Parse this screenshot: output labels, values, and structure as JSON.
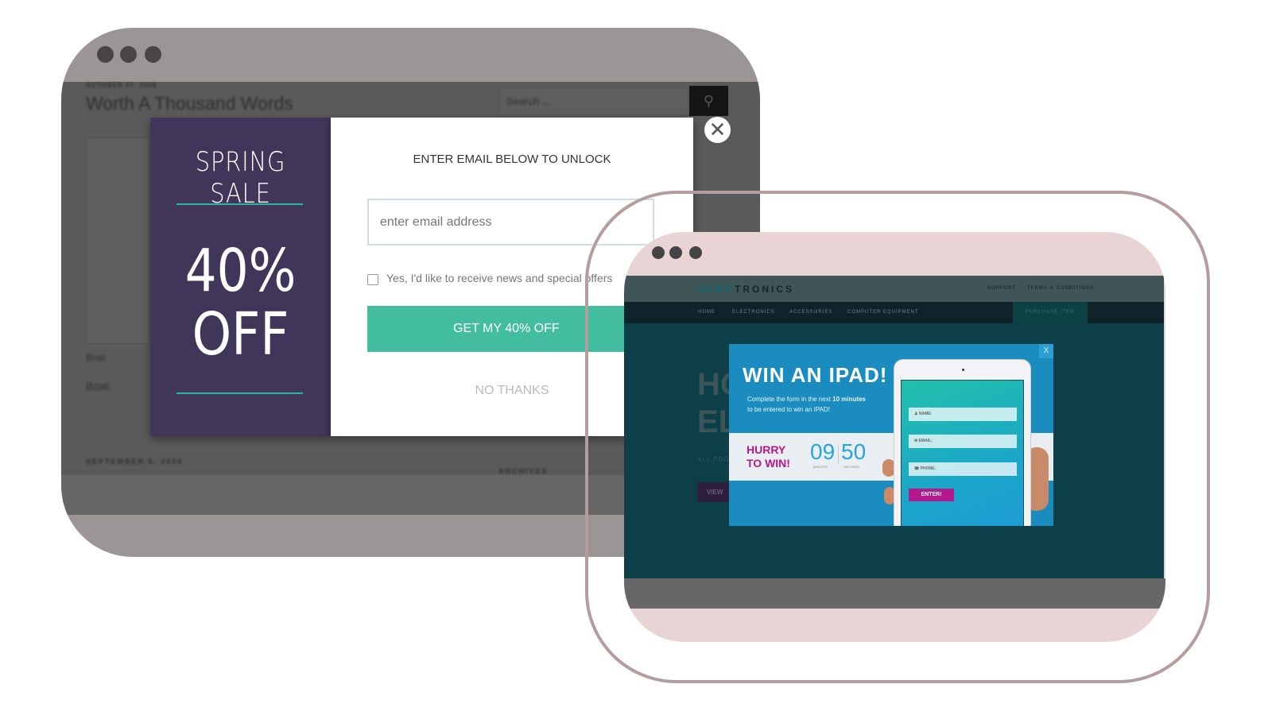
{
  "left_window": {
    "background": {
      "date1": "OCTOBER 27, 2008",
      "post_title": "Worth A Thousand Words",
      "search_placeholder": "Search ...",
      "caption1": "Boat",
      "caption2": "Boat.",
      "date2": "SEPTEMBER 5, 2008",
      "archives": "ARCHIVES"
    },
    "popup": {
      "headline": "SPRING SALE",
      "discount_line1": "40%",
      "discount_line2": "OFF",
      "prompt": "ENTER EMAIL BELOW TO UNLOCK",
      "email_placeholder": "enter email address",
      "checkbox_label": "Yes, I'd like to receive news and special offers",
      "cta": "GET MY 40% OFF",
      "decline": "NO THANKS",
      "close_icon": "close-icon",
      "colors": {
        "panel": "#403659",
        "cta": "#42bda0"
      }
    }
  },
  "right_window": {
    "site": {
      "brand_a": "OLEG",
      "brand_b": "TRONICS",
      "top_links": [
        "SUPPORT",
        "TERMS & CONDITIONS"
      ],
      "nav": [
        "HOME",
        "ELECTRONICS",
        "ACCESSORIES",
        "COMPUTER EQUIPMENT"
      ],
      "purchase": "PURCHASE ITEM",
      "hero_l1": "HO",
      "hero_l2": "EL",
      "hero_sub": "ALL PRO",
      "hero_btn": "VIEW"
    },
    "popup": {
      "title": "WIN AN IPAD!",
      "desc_pre": "Complete the form in the next ",
      "desc_bold": "10 minutes",
      "desc_post": "to be entered to win an IPAD!",
      "hurry1": "HURRY",
      "hurry2": "TO WIN!",
      "minutes": "09",
      "minutes_label": "MINUTES",
      "seconds": "50",
      "seconds_label": "SECONDS",
      "fields": [
        "NAME:",
        "EMAIL:",
        "PHONE:"
      ],
      "submit": "ENTER!",
      "close": "X",
      "colors": {
        "bg": "#1a8cc0",
        "accent": "#b5178c"
      }
    }
  }
}
